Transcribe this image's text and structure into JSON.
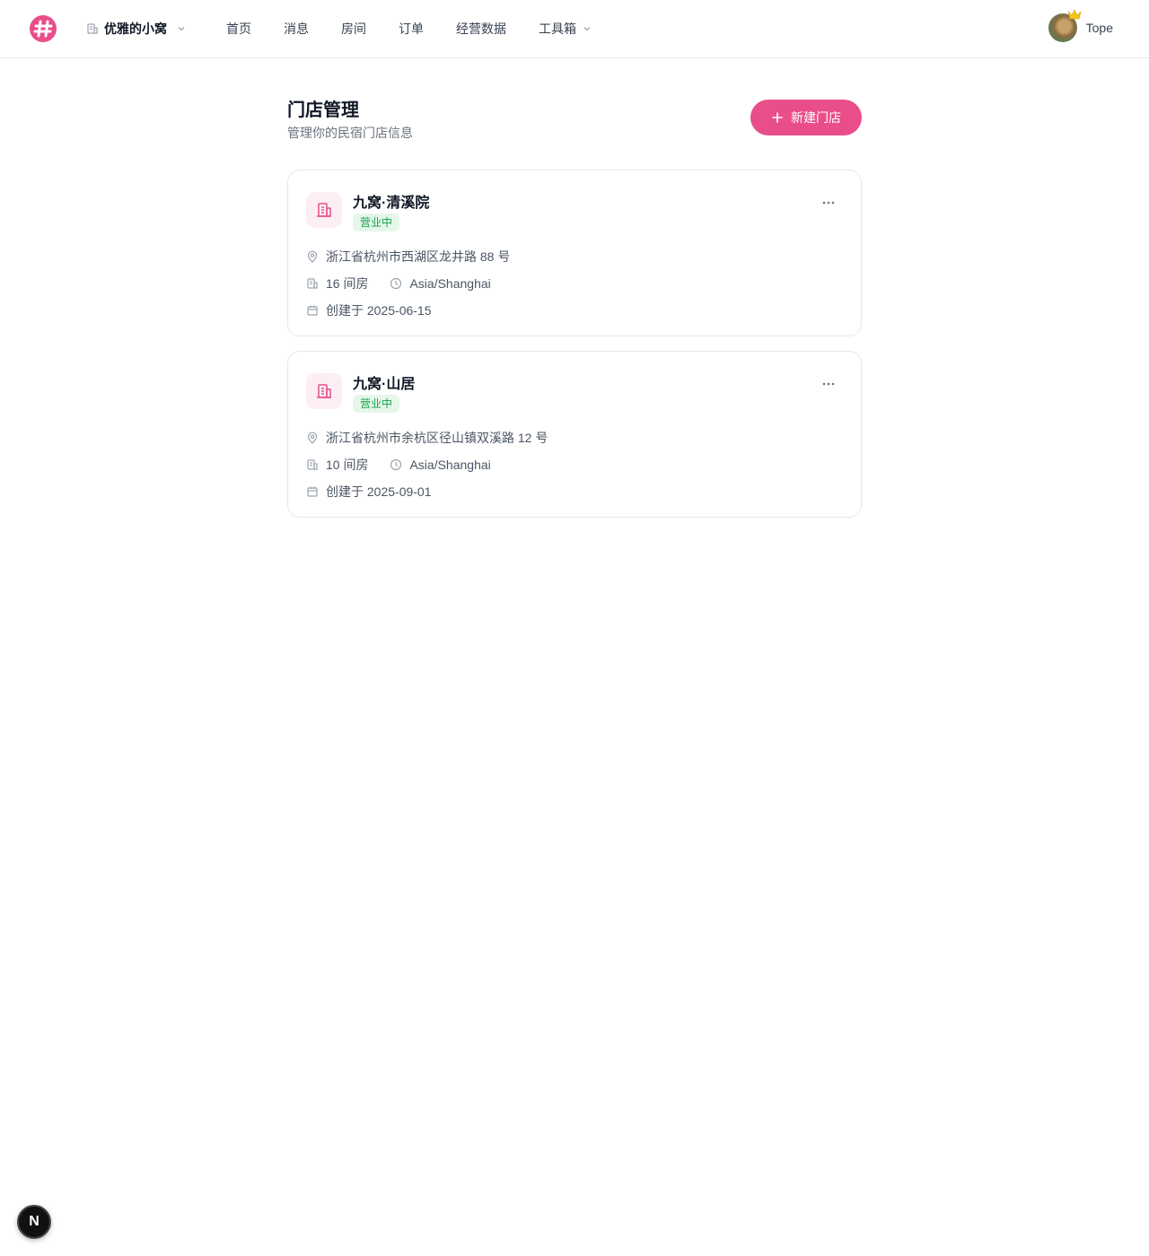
{
  "header": {
    "store_selector": "优雅的小窝",
    "nav": [
      {
        "label": "首页"
      },
      {
        "label": "消息"
      },
      {
        "label": "房间"
      },
      {
        "label": "订单"
      },
      {
        "label": "经营数据"
      },
      {
        "label": "工具箱",
        "has_dropdown": true
      }
    ],
    "user_name": "Tope",
    "brand_color": "#e94e8a"
  },
  "page": {
    "title": "门店管理",
    "subtitle": "管理你的民宿门店信息",
    "new_button_label": "新建门店"
  },
  "stores": [
    {
      "name": "九窝·清溪院",
      "status": "营业中",
      "address": "浙江省杭州市西湖区龙井路 88 号",
      "rooms": "16 间房",
      "timezone": "Asia/Shanghai",
      "created": "创建于 2025-06-15"
    },
    {
      "name": "九窝·山居",
      "status": "营业中",
      "address": "浙江省杭州市余杭区径山镇双溪路 12 号",
      "rooms": "10 间房",
      "timezone": "Asia/Shanghai",
      "created": "创建于 2025-09-01"
    }
  ],
  "dev_badge": "N"
}
